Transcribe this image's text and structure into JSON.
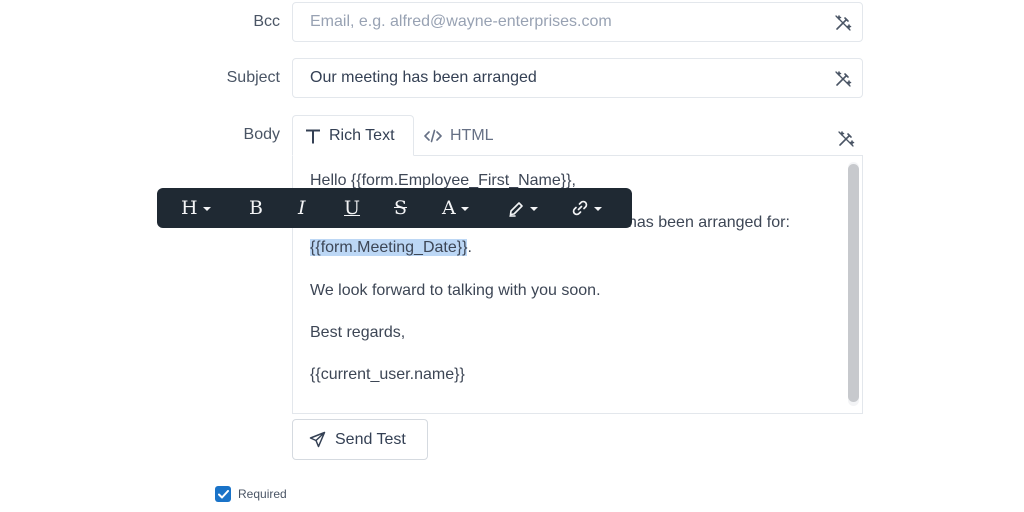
{
  "bcc": {
    "label": "Bcc",
    "placeholder": "Email, e.g. alfred@wayne-enterprises.com"
  },
  "subject": {
    "label": "Subject",
    "value": "Our meeting has been arranged"
  },
  "body": {
    "label": "Body",
    "tabs": [
      {
        "label": "Rich Text",
        "active": true
      },
      {
        "label": "HTML",
        "active": false
      }
    ],
    "lines": {
      "greeting": "Hello {{form.Employee_First_Name}},",
      "arranged_tail": "has been arranged for:",
      "date_var": "{{form.Meeting_Date}}",
      "date_period": ".",
      "forward": "We look forward to talking with you soon.",
      "regards": "Best regards,",
      "signature": "{{current_user.name}}"
    }
  },
  "toolbar": {
    "heading": "H",
    "bold": "B",
    "italic": "I",
    "underline": "U",
    "strike": "S",
    "font_color": "A",
    "icons": [
      "heading-icon",
      "bold-icon",
      "italic-icon",
      "underline-icon",
      "strikethrough-icon",
      "font-color-icon",
      "highlighter-icon",
      "link-icon"
    ]
  },
  "send_test": {
    "label": "Send Test"
  },
  "required": {
    "label": "Required",
    "checked": true
  },
  "colors": {
    "toolbar_bg": "#1f2933",
    "checkbox": "#1a73c8",
    "selection": "#bcd7f5"
  }
}
